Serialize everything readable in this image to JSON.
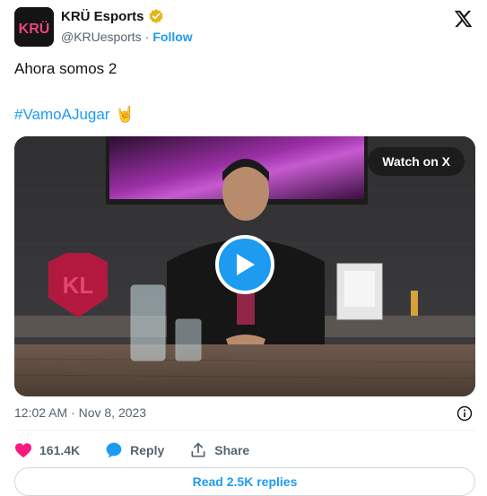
{
  "account": {
    "name": "KRÜ Esports",
    "handle": "@KRUesports",
    "follow_label": "Follow",
    "logo_text": "KRÜ",
    "verified_color": "#e2b719"
  },
  "tweet": {
    "text": "Ahora somos 2",
    "hashtag": "#VamoAJugar",
    "emoji": "🤘"
  },
  "media": {
    "watch_label": "Watch on X",
    "play_icon": "play-icon"
  },
  "meta": {
    "timestamp": "12:02 AM · Nov 8, 2023"
  },
  "actions": {
    "likes": "161.4K",
    "reply_label": "Reply",
    "share_label": "Share"
  },
  "replies_button": "Read 2.5K replies",
  "colors": {
    "accent": "#1d9bf0",
    "like": "#f91880",
    "text": "#0f1419",
    "muted": "#536471"
  }
}
